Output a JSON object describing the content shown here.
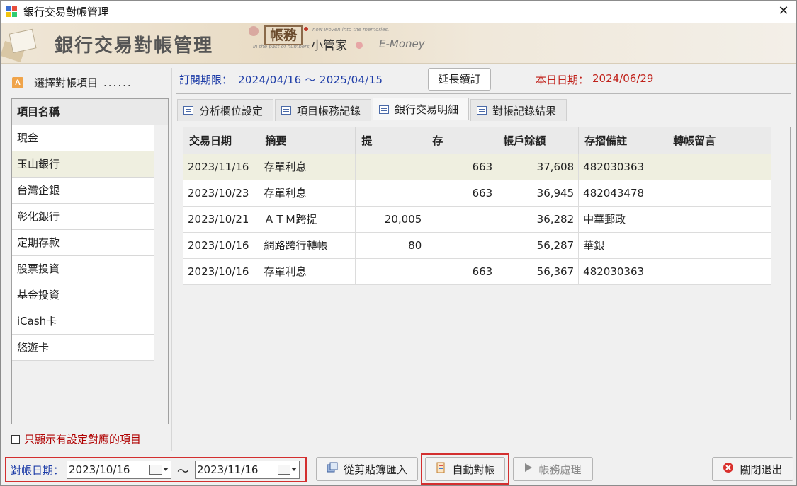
{
  "window": {
    "title": "銀行交易對帳管理",
    "close_glyph": "✕"
  },
  "banner": {
    "title": "銀行交易對帳管理",
    "logo_box": "帳務",
    "logo_main": "小管家",
    "logo_tag1": "now woven into the memories.",
    "logo_tag2": "in the past of numbers,",
    "emoney": "E-Money"
  },
  "left": {
    "badge": "A",
    "header_label": "選擇對帳項目",
    "header_dots": "......",
    "list_header": "項目名稱",
    "items": [
      {
        "label": "現金"
      },
      {
        "label": "玉山銀行"
      },
      {
        "label": "台灣企銀"
      },
      {
        "label": "彰化銀行"
      },
      {
        "label": "定期存款"
      },
      {
        "label": "股票投資"
      },
      {
        "label": "基金投資"
      },
      {
        "label": "iCash卡"
      },
      {
        "label": "悠遊卡"
      }
    ],
    "checkbox_label": "只顯示有設定對應的項目"
  },
  "subscription": {
    "label": "訂閱期限：",
    "dates": "2024/04/16 ～ 2025/04/15",
    "extend_button": "延長續訂",
    "today_label": "本日日期：",
    "today_date": "2024/06/29"
  },
  "tabs": [
    {
      "label": "分析欄位設定"
    },
    {
      "label": "項目帳務記錄"
    },
    {
      "label": "銀行交易明細"
    },
    {
      "label": "對帳記錄結果"
    }
  ],
  "grid": {
    "columns": [
      "交易日期",
      "摘要",
      "提",
      "存",
      "帳戶餘額",
      "存摺備註",
      "轉帳留言"
    ],
    "rows": [
      {
        "date": "2023/11/16",
        "summary": "存單利息",
        "withdraw": "",
        "deposit": "663",
        "balance": "37,608",
        "note": "482030363",
        "msg": ""
      },
      {
        "date": "2023/10/23",
        "summary": "存單利息",
        "withdraw": "",
        "deposit": "663",
        "balance": "36,945",
        "note": "482043478",
        "msg": ""
      },
      {
        "date": "2023/10/21",
        "summary": "ＡＴＭ跨提",
        "withdraw": "20,005",
        "deposit": "",
        "balance": "36,282",
        "note": "中華郵政",
        "msg": ""
      },
      {
        "date": "2023/10/16",
        "summary": "網路跨行轉帳",
        "withdraw": "80",
        "deposit": "",
        "balance": "56,287",
        "note": "華銀",
        "msg": ""
      },
      {
        "date": "2023/10/16",
        "summary": "存單利息",
        "withdraw": "",
        "deposit": "663",
        "balance": "56,367",
        "note": "482030363",
        "msg": ""
      }
    ]
  },
  "bottom": {
    "date_label": "對帳日期：",
    "date_from": "2023/10/16",
    "tilde": "～",
    "date_to": "2023/11/16",
    "import_button": "從剪貼簿匯入",
    "auto_button": "自動對帳",
    "process_button": "帳務處理",
    "exit_button": "關閉退出"
  }
}
